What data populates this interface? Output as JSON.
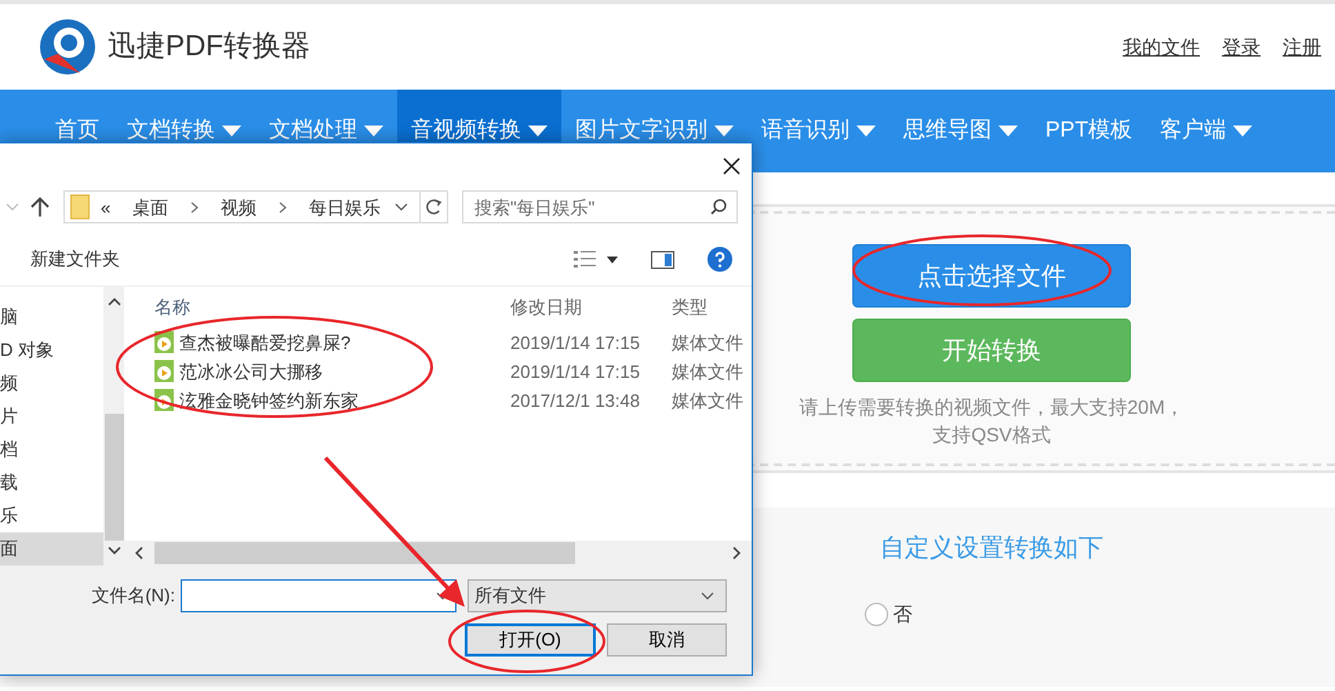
{
  "site": {
    "logo_text": "迅捷PDF转换器",
    "links": [
      "我的文件",
      "登录",
      "注册"
    ]
  },
  "nav": [
    {
      "label": "首页",
      "selected": false,
      "dropdown": false
    },
    {
      "label": "文档转换",
      "selected": false,
      "dropdown": true
    },
    {
      "label": "文档处理",
      "selected": false,
      "dropdown": true
    },
    {
      "label": "音视频转换",
      "selected": true,
      "dropdown": true
    },
    {
      "label": "图片文字识别",
      "selected": false,
      "dropdown": true
    },
    {
      "label": "语音识别",
      "selected": false,
      "dropdown": true
    },
    {
      "label": "思维导图",
      "selected": false,
      "dropdown": true
    },
    {
      "label": "PPT模板",
      "selected": false,
      "dropdown": false
    },
    {
      "label": "客户端",
      "selected": false,
      "dropdown": true
    }
  ],
  "upload": {
    "select_button": "点击选择文件",
    "convert_button": "开始转换",
    "hint": "请上传需要转换的视频文件，最大支持20M，支持QSV格式"
  },
  "settings": {
    "title": "自定义设置转换如下",
    "options": [
      {
        "label": "否",
        "selected": false
      }
    ]
  },
  "dialog": {
    "path_prefix": "«",
    "path": [
      "桌面",
      "视频",
      "每日娱乐"
    ],
    "search": {
      "placeholder": "搜索\"每日娱乐\""
    },
    "new_folder": "新建文件夹",
    "sidebar": [
      {
        "label": "脑",
        "selected": false
      },
      {
        "label": "D 对象",
        "selected": false
      },
      {
        "label": "频",
        "selected": false
      },
      {
        "label": "片",
        "selected": false
      },
      {
        "label": "档",
        "selected": false
      },
      {
        "label": "载",
        "selected": false
      },
      {
        "label": "乐",
        "selected": false
      },
      {
        "label": "面",
        "selected": true
      }
    ],
    "columns": [
      "名称",
      "修改日期",
      "类型"
    ],
    "files": [
      {
        "name": "查杰被曝酷爱挖鼻屎?",
        "modified": "2019/1/14 17:15",
        "type": "媒体文件"
      },
      {
        "name": "范冰冰公司大挪移",
        "modified": "2019/1/14 17:15",
        "type": "媒体文件"
      },
      {
        "name": "泫雅金晓钟签约新东家",
        "modified": "2017/12/1 13:48",
        "type": "媒体文件"
      }
    ],
    "filename_label": "文件名(N):",
    "filter": "所有文件",
    "buttons": [
      {
        "label": "打开(O)",
        "kind": "primary"
      },
      {
        "label": "取消",
        "kind": "secondary"
      }
    ]
  }
}
